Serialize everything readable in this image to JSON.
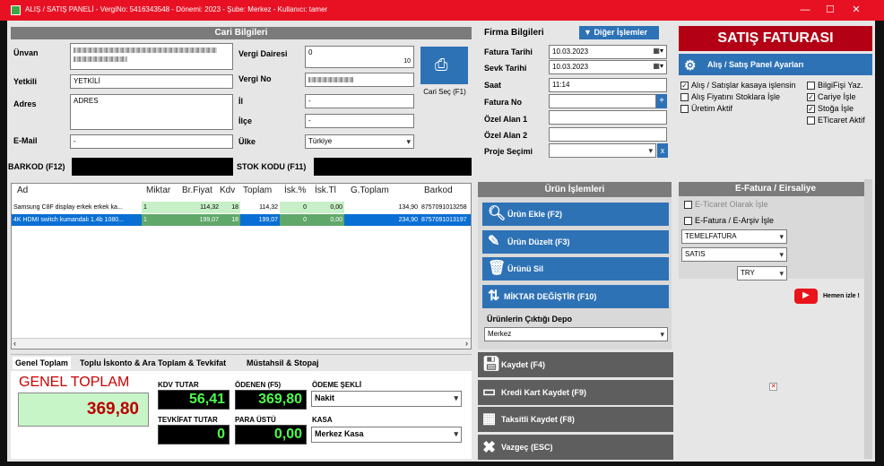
{
  "window": {
    "title": "ALIŞ / SATIŞ PANELİ - VergiNo: 5416343548 - Dönemi: 2023 - Şube: Merkez - Kullanıcı: tamer",
    "min": "—",
    "max": "☐",
    "close": "✕"
  },
  "cari": {
    "header": "Cari Bilgileri",
    "unvan_label": "Ünvan",
    "yetkili_label": "Yetkili",
    "yetkili_value": "YETKİLİ",
    "adres_label": "Adres",
    "adres_value": "ADRES",
    "email_label": "E-Mail",
    "email_value": "-",
    "vergi_dairesi_label": "Vergi Dairesi",
    "vergi_dairesi_value": "0",
    "counter": "10",
    "vergi_no_label": "Vergi No",
    "il_label": "İl",
    "il_value": "-",
    "ilce_label": "İlçe",
    "ilce_value": "-",
    "ulke_label": "Ülke",
    "ulke_value": "Türkiye",
    "cari_sec": "Cari Seç (F1)"
  },
  "barcode": {
    "barkod_label": "BARKOD (F12)",
    "stok_label": "STOK KODU (F11)"
  },
  "firma": {
    "header": "Firma Bilgileri",
    "diger": "Diğer İşlemler",
    "fatura_tarihi_label": "Fatura Tarihi",
    "fatura_tarihi": "10.03.2023",
    "sevk_tarihi_label": "Sevk Tarihi",
    "sevk_tarihi": "10.03.2023",
    "saat_label": "Saat",
    "saat": "11:14",
    "fatura_no_label": "Fatura No",
    "ozel1_label": "Özel Alan 1",
    "ozel2_label": "Özel Alan 2",
    "proje_label": "Proje Seçimi",
    "plus": "+",
    "x": "x"
  },
  "satis": {
    "title": "SATIŞ FATURASI",
    "ayarlar": "Alış / Satış Panel Ayarları",
    "opt1": "Alış / Satışlar kasaya işlensin",
    "opt2": "Alış Fiyatını Stoklara İşle",
    "opt3": "Üretim Aktif",
    "opt4": "BilgiFişi Yaz.",
    "opt5": "Cariye İşle",
    "opt6": "Stoğa İşle",
    "opt7": "ETicaret Aktif"
  },
  "table": {
    "headers": [
      "Ad",
      "Miktar",
      "Br.Fiyat",
      "Kdv",
      "Toplam",
      "İsk.%",
      "İsk.Tl",
      "G.Toplam",
      "Barkod"
    ],
    "rows": [
      [
        "Samsung C8F display erkek erkek ka...",
        "1",
        "114,32",
        "18",
        "114,32",
        "0",
        "0,00",
        "134,90",
        "8757091013258"
      ],
      [
        "4K HDMI switch kumandalı 1.4b 1080...",
        "1",
        "199,07",
        "18",
        "199,07",
        "0",
        "0,00",
        "234,90",
        "8757091013197"
      ]
    ]
  },
  "urun": {
    "header": "Ürün İşlemleri",
    "ekle": "Ürün Ekle (F2)",
    "duzelt": "Ürün Düzelt (F3)",
    "sil": "Ürünü Sil",
    "miktar": "MİKTAR DEĞİŞTİR (F10)",
    "depo_label": "Ürünlerin Çıktığı Depo",
    "depo": "Merkez"
  },
  "actions": {
    "kaydet": "Kaydet (F4)",
    "kredi": "Kredi Kart Kaydet (F9)",
    "taksit": "Taksitli Kaydet (F8)",
    "vazgec": "Vazgeç (ESC)"
  },
  "efatura": {
    "header": "E-Fatura / Eirsaliye",
    "eticaret": "E-Ticaret Olarak İşle",
    "earsiv": "E-Fatura / E-Arşiv İşle",
    "sel1": "TEMELFATURA",
    "sel2": "SATIS",
    "currency": "TRY",
    "izle": "Hemen izle !"
  },
  "tabs": {
    "t1": "Genel Toplam",
    "t2": "Toplu İskonto & Ara Toplam & Tevkifat",
    "t3": "Müstahsil & Stopaj"
  },
  "totals": {
    "genel_label": "GENEL TOPLAM",
    "genel": "369,80",
    "kdv_label": "KDV TUTAR",
    "kdv": "56,41",
    "odenen_label": "ÖDENEN (F5)",
    "odenen": "369,80",
    "odeme_label": "ÖDEME ŞEKLİ",
    "odeme": "Nakit",
    "tevkifat_label": "TEVKİFAT TUTAR",
    "tevkifat": "0",
    "para_label": "PARA ÜSTÜ",
    "para": "0,00",
    "kasa_label": "KASA",
    "kasa": "Merkez Kasa"
  }
}
